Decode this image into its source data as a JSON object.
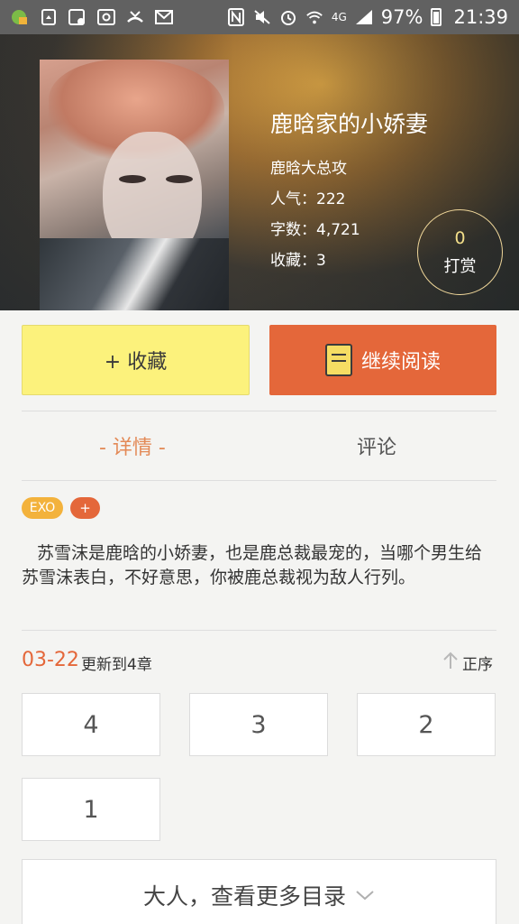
{
  "status_bar": {
    "left_icons": [
      "app-icon",
      "recycle-icon",
      "screen-icon",
      "at-icon",
      "missed-call-icon",
      "mail-icon"
    ],
    "right_icons": [
      "nfc-icon",
      "mute-icon",
      "alarm-icon",
      "wifi-icon",
      "signal-icon"
    ],
    "network": "4G",
    "battery": "97%",
    "time": "21:39"
  },
  "book": {
    "title": "鹿晗家的小娇妻",
    "author": "鹿晗大总攻",
    "popularity": "人气：222",
    "word_count": "字数：4,721",
    "favorites": "收藏：3"
  },
  "reward": {
    "count": "0",
    "label": "打赏"
  },
  "actions": {
    "favorite": "+ 收藏",
    "continue_reading": "继续阅读"
  },
  "tabs": {
    "detail": "- 详情 -",
    "comments": "评论"
  },
  "tags": {
    "exo": "EXO",
    "add": "+"
  },
  "description": "苏雪沫是鹿晗的小娇妻，也是鹿总裁最宠的，当哪个男生给苏雪沫表白，不好意思，你被鹿总裁视为敌人行列。",
  "update": {
    "date": "03-22",
    "text": "更新到4章",
    "sort": "正序"
  },
  "chapters": [
    "4",
    "3",
    "2",
    "1"
  ],
  "more_label": "大人，查看更多目录",
  "colors": {
    "accent": "#e4673a",
    "favorite_bg": "#fcf27c",
    "tag_yellow": "#f3b23c",
    "tab_active": "#e38956"
  }
}
